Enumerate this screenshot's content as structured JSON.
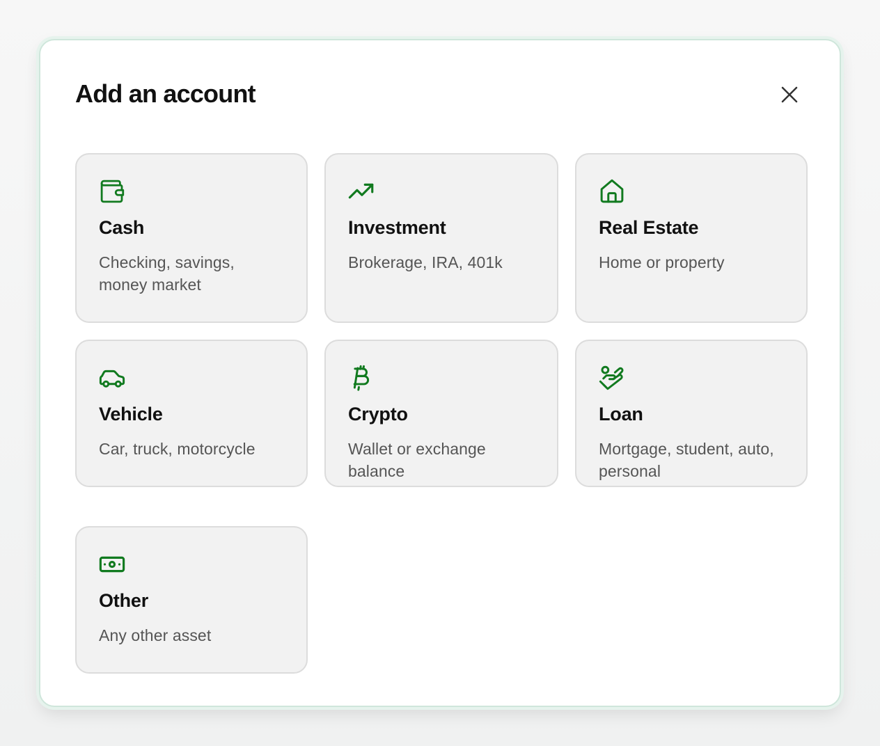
{
  "modal": {
    "title": "Add an account",
    "close_icon": "close-icon"
  },
  "accent_color": "#117a1f",
  "options": [
    {
      "label": "Cash",
      "description": "Checking, savings, money market",
      "icon": "wallet-icon"
    },
    {
      "label": "Investment",
      "description": "Brokerage, IRA, 401k",
      "icon": "trending-up-icon"
    },
    {
      "label": "Real Estate",
      "description": "Home or property",
      "icon": "house-icon"
    },
    {
      "label": "Vehicle",
      "description": "Car, truck, motorcycle",
      "icon": "car-icon"
    },
    {
      "label": "Crypto",
      "description": "Wallet or exchange balance",
      "icon": "bitcoin-icon"
    },
    {
      "label": "Loan",
      "description": "Mortgage, student, auto, personal",
      "icon": "hand-coins-icon"
    },
    {
      "label": "Other",
      "description": "Any other asset",
      "icon": "banknote-icon"
    }
  ]
}
